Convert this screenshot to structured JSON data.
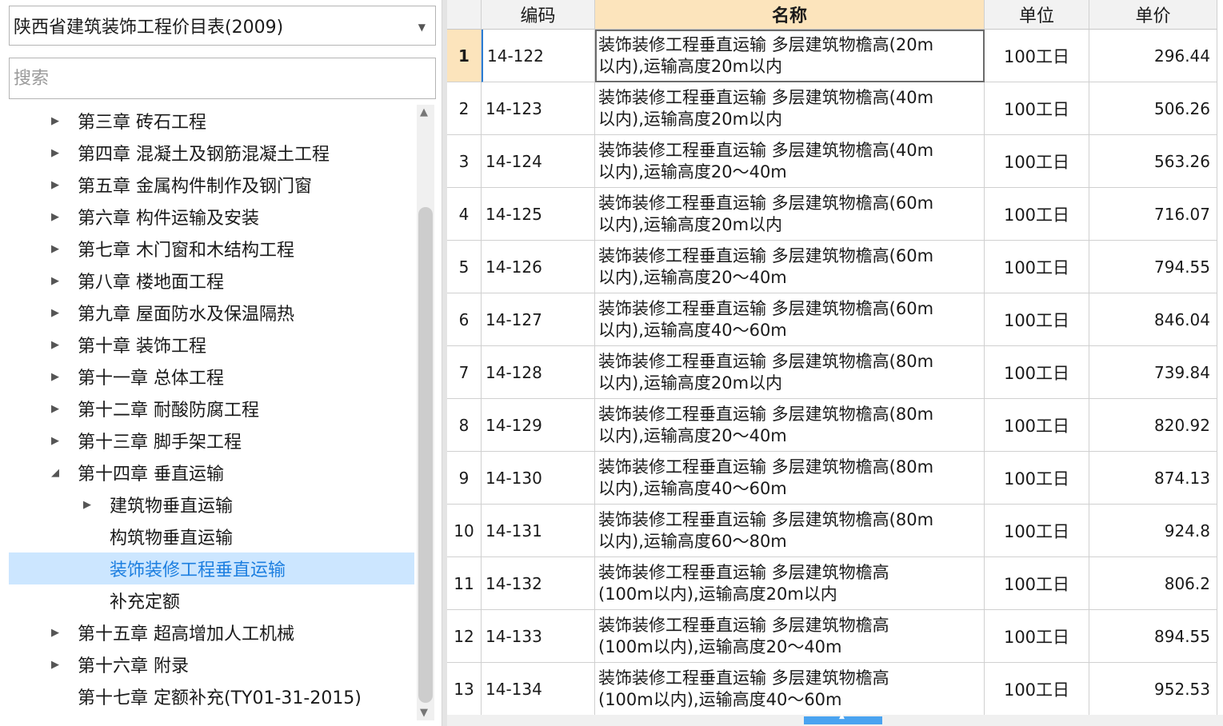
{
  "library": {
    "selected": "陕西省建筑装饰工程价目表(2009)"
  },
  "search": {
    "placeholder": "搜索"
  },
  "tree": [
    {
      "label": "第三章 砖石工程",
      "level": 0,
      "state": "collapsed"
    },
    {
      "label": "第四章 混凝土及钢筋混凝土工程",
      "level": 0,
      "state": "collapsed"
    },
    {
      "label": "第五章 金属构件制作及钢门窗",
      "level": 0,
      "state": "collapsed"
    },
    {
      "label": "第六章 构件运输及安装",
      "level": 0,
      "state": "collapsed"
    },
    {
      "label": "第七章 木门窗和木结构工程",
      "level": 0,
      "state": "collapsed"
    },
    {
      "label": "第八章 楼地面工程",
      "level": 0,
      "state": "collapsed"
    },
    {
      "label": "第九章 屋面防水及保温隔热",
      "level": 0,
      "state": "collapsed"
    },
    {
      "label": "第十章 装饰工程",
      "level": 0,
      "state": "collapsed"
    },
    {
      "label": "第十一章 总体工程",
      "level": 0,
      "state": "collapsed"
    },
    {
      "label": "第十二章 耐酸防腐工程",
      "level": 0,
      "state": "collapsed"
    },
    {
      "label": "第十三章 脚手架工程",
      "level": 0,
      "state": "collapsed"
    },
    {
      "label": "第十四章 垂直运输",
      "level": 0,
      "state": "expanded"
    },
    {
      "label": "建筑物垂直运输",
      "level": 1,
      "state": "collapsed"
    },
    {
      "label": "构筑物垂直运输",
      "level": 1,
      "state": "leaf"
    },
    {
      "label": "装饰装修工程垂直运输",
      "level": 1,
      "state": "leaf",
      "selected": true
    },
    {
      "label": "补充定额",
      "level": 1,
      "state": "leaf"
    },
    {
      "label": "第十五章 超高增加人工机械",
      "level": 0,
      "state": "collapsed"
    },
    {
      "label": "第十六章 附录",
      "level": 0,
      "state": "collapsed"
    },
    {
      "label": "第十七章 定额补充(TY01-31-2015)",
      "level": 0,
      "state": "leaf"
    }
  ],
  "grid": {
    "columns": {
      "code": "编码",
      "name": "名称",
      "unit": "单位",
      "price": "单价"
    },
    "current_row": 1,
    "rows": [
      {
        "idx": "1",
        "code": "14-122",
        "name1": "装饰装修工程垂直运输 多层建筑物檐高(20m",
        "name2": "以内),运输高度20m以内",
        "unit": "100工日",
        "price": "296.44"
      },
      {
        "idx": "2",
        "code": "14-123",
        "name1": "装饰装修工程垂直运输 多层建筑物檐高(40m",
        "name2": "以内),运输高度20m以内",
        "unit": "100工日",
        "price": "506.26"
      },
      {
        "idx": "3",
        "code": "14-124",
        "name1": "装饰装修工程垂直运输 多层建筑物檐高(40m",
        "name2": "以内),运输高度20～40m",
        "unit": "100工日",
        "price": "563.26"
      },
      {
        "idx": "4",
        "code": "14-125",
        "name1": "装饰装修工程垂直运输 多层建筑物檐高(60m",
        "name2": "以内),运输高度20m以内",
        "unit": "100工日",
        "price": "716.07"
      },
      {
        "idx": "5",
        "code": "14-126",
        "name1": "装饰装修工程垂直运输 多层建筑物檐高(60m",
        "name2": "以内),运输高度20～40m",
        "unit": "100工日",
        "price": "794.55"
      },
      {
        "idx": "6",
        "code": "14-127",
        "name1": "装饰装修工程垂直运输 多层建筑物檐高(60m",
        "name2": "以内),运输高度40～60m",
        "unit": "100工日",
        "price": "846.04"
      },
      {
        "idx": "7",
        "code": "14-128",
        "name1": "装饰装修工程垂直运输 多层建筑物檐高(80m",
        "name2": "以内),运输高度20m以内",
        "unit": "100工日",
        "price": "739.84"
      },
      {
        "idx": "8",
        "code": "14-129",
        "name1": "装饰装修工程垂直运输 多层建筑物檐高(80m",
        "name2": "以内),运输高度20～40m",
        "unit": "100工日",
        "price": "820.92"
      },
      {
        "idx": "9",
        "code": "14-130",
        "name1": "装饰装修工程垂直运输 多层建筑物檐高(80m",
        "name2": "以内),运输高度40～60m",
        "unit": "100工日",
        "price": "874.13"
      },
      {
        "idx": "10",
        "code": "14-131",
        "name1": "装饰装修工程垂直运输 多层建筑物檐高(80m",
        "name2": "以内),运输高度60～80m",
        "unit": "100工日",
        "price": "924.8"
      },
      {
        "idx": "11",
        "code": "14-132",
        "name1": "装饰装修工程垂直运输 多层建筑物檐高",
        "name2": "(100m以内),运输高度20m以内",
        "unit": "100工日",
        "price": "806.2"
      },
      {
        "idx": "12",
        "code": "14-133",
        "name1": "装饰装修工程垂直运输 多层建筑物檐高",
        "name2": "(100m以内),运输高度20～40m",
        "unit": "100工日",
        "price": "894.55"
      },
      {
        "idx": "13",
        "code": "14-134",
        "name1": "装饰装修工程垂直运输 多层建筑物檐高",
        "name2": "(100m以内),运输高度40～60m",
        "unit": "100工日",
        "price": "952.53"
      }
    ]
  },
  "icons": {
    "collapsed": "triangle-right-icon",
    "expanded": "triangle-down-icon",
    "dropdown": "chevron-down-icon"
  },
  "colors": {
    "selection_bg": "#cce6ff",
    "selection_text": "#1d7fe0",
    "active_header": "#fce4bc",
    "scroll_thumb": "#4aa3f0"
  }
}
